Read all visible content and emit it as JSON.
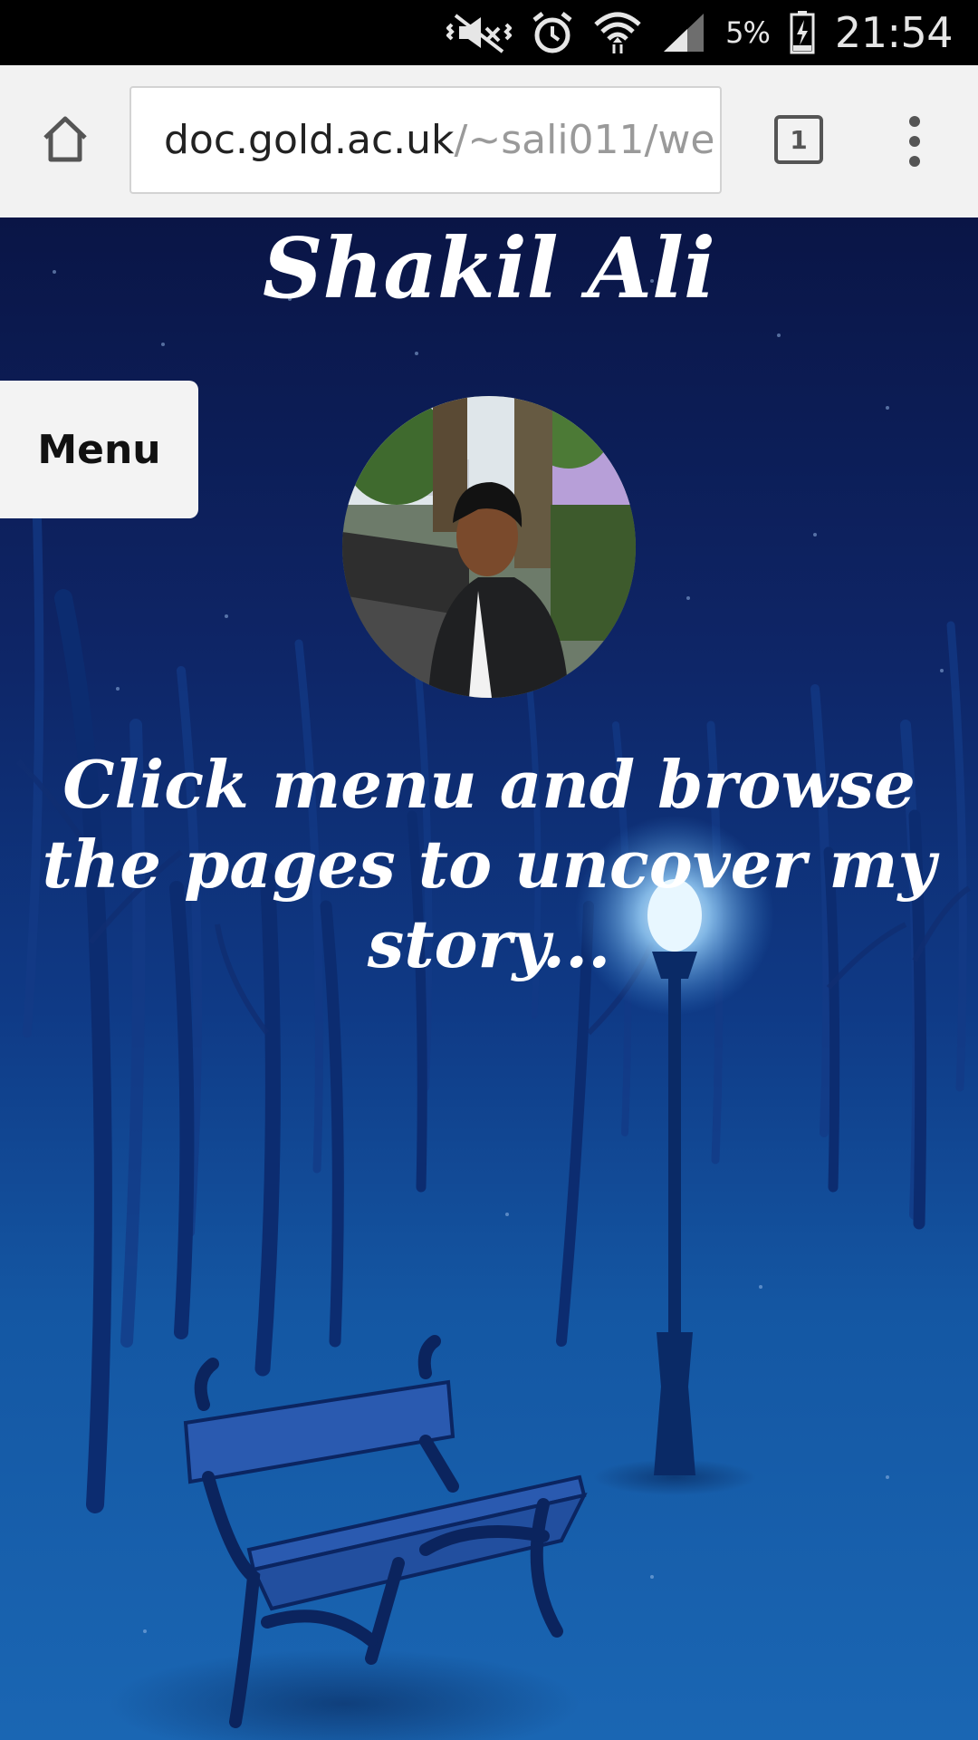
{
  "status_bar": {
    "icons": [
      "mute-vibrate-icon",
      "alarm-icon",
      "wifi-icon",
      "signal-icon",
      "battery-icon"
    ],
    "battery": "5%",
    "time": "21:54"
  },
  "browser": {
    "url_host": "doc.gold.ac.uk",
    "url_path": "/~sali011/we",
    "tab_count": "1",
    "icons": [
      "home-icon",
      "tab-switcher-icon",
      "more-vert-icon"
    ]
  },
  "page": {
    "title": "Shakil Ali",
    "menu_label": "Menu",
    "tagline": "Click menu and browse the pages to uncover my story...",
    "background_colors": {
      "top": "#0a1546",
      "bottom": "#1a66b3",
      "lamp_glow": "#bfe6ff"
    }
  }
}
